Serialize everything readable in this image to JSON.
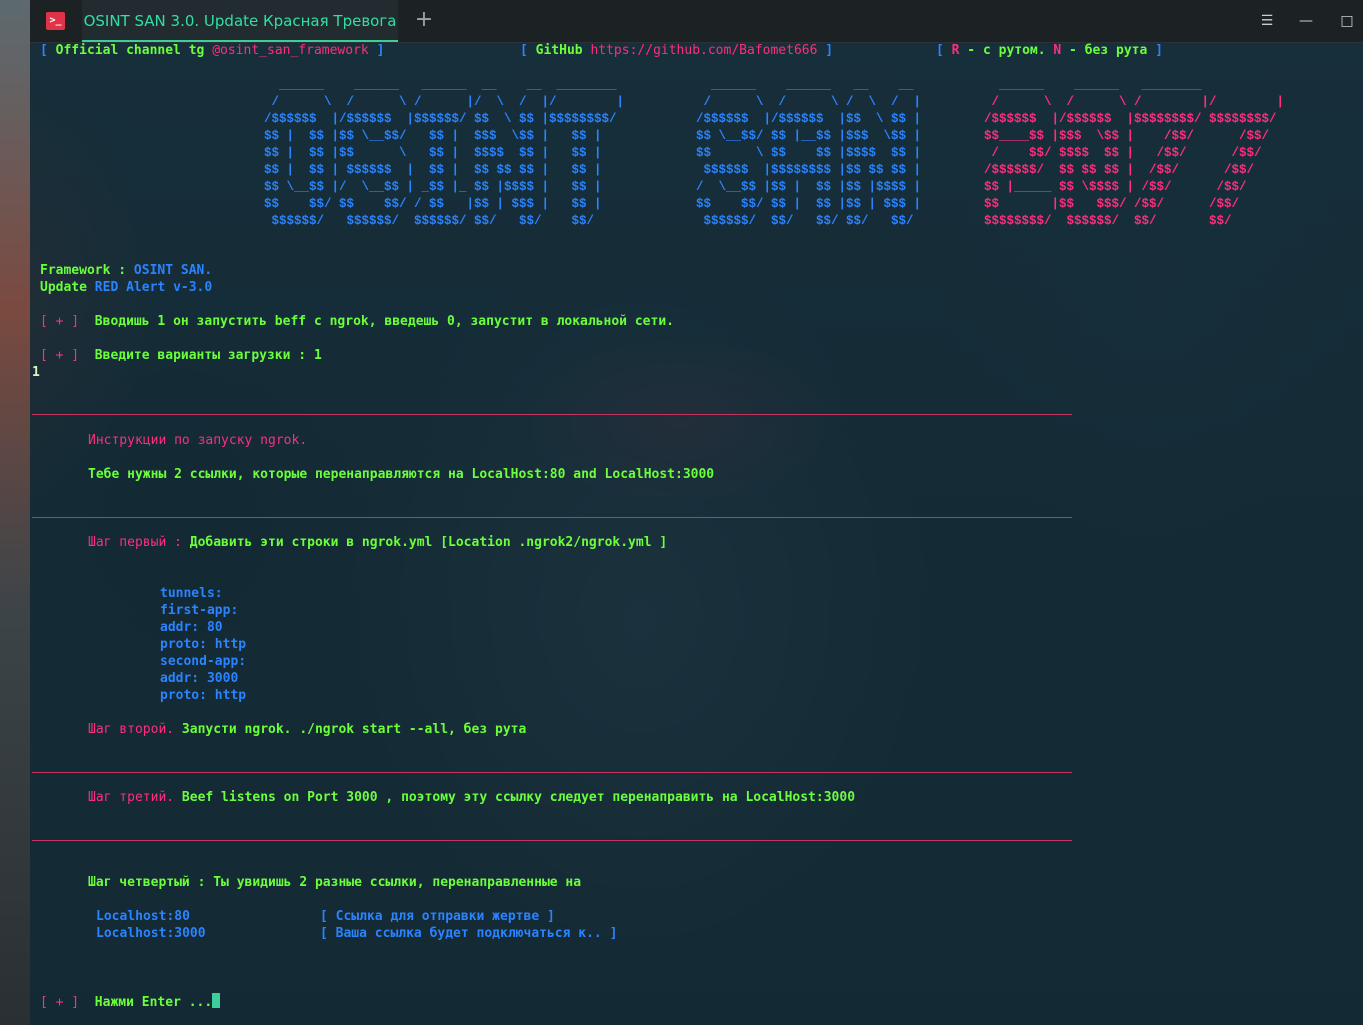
{
  "window": {
    "tab_title": "OSINT SAN 3.0. Update Красная Тревога",
    "new_tab": "+",
    "menu_glyph": "☰",
    "minimize_glyph": "—",
    "maximize_glyph": "□"
  },
  "header": {
    "channel_bracket_open": "[",
    "channel_label": "Official channel tg",
    "channel_handle": "@osint_san_framework",
    "channel_bracket_close": "]",
    "github_bracket_open": "[",
    "github_label": "GitHub",
    "github_url": "https://github.com/Bafomet666",
    "github_bracket_close": "]",
    "mode_bracket_open": "[",
    "mode_r": "R",
    "mode_r_text": " - с рутом.",
    "mode_n": "N",
    "mode_n_text": " - без рута",
    "mode_bracket_close": "]"
  },
  "banner": {
    "osint": "  ______    ______   ______  __    __  ________\n /      \\  /      \\ /      |/  \\  /  |/        |\n/$$$$$$  |/$$$$$$  |$$$$$$/ $$  \\ $$ |$$$$$$$$/\n$$ |  $$ |$$ \\__$$/   $$ |  $$$  \\$$ |   $$ |\n$$ |  $$ |$$      \\   $$ |  $$$$  $$ |   $$ |\n$$ |  $$ | $$$$$$  |  $$ |  $$ $$ $$ |   $$ |\n$$ \\__$$ |/  \\__$$ | _$$ |_ $$ |$$$$ |   $$ |\n$$    $$/ $$    $$/ / $$   |$$ | $$$ |   $$ |\n $$$$$$/   $$$$$$/  $$$$$$/ $$/   $$/    $$/",
    "san": "  ______    ______   __    __\n /      \\  /      \\ /  \\  /  |\n/$$$$$$  |/$$$$$$  |$$  \\ $$ |\n$$ \\__$$/ $$ |__$$ |$$$  \\$$ |\n$$      \\ $$    $$ |$$$$  $$ |\n $$$$$$  |$$$$$$$$ |$$ $$ $$ |\n/  \\__$$ |$$ |  $$ |$$ |$$$$ |\n$$    $$/ $$ |  $$ |$$ | $$$ |\n $$$$$$/  $$/   $$/ $$/   $$/",
    "v207": "  ______    ______   ________\n /      \\  /      \\ /        |/        |\n/$$$$$$  |/$$$$$$  |$$$$$$$$/ $$$$$$$$/\n$$____$$ |$$$  \\$$ |    /$$/      /$$/\n /    $$/ $$$$  $$ |   /$$/      /$$/\n/$$$$$$/  $$ $$ $$ |  /$$/      /$$/\n$$ |_____ $$ \\$$$$ | /$$/      /$$/\n$$       |$$   $$$/ /$$/      /$$/\n$$$$$$$$/  $$$$$$/  $$/       $$/"
  },
  "info": {
    "framework_label": "Framework : ",
    "framework_value": "OSINT SAN.",
    "update_label": "Update ",
    "update_value": "RED Alert v-3.0"
  },
  "prompts": {
    "marker": "[ + ]",
    "hint": "Вводишь 1 он запустить beff с ngrok, введешь 0, запустит в локальной сети.",
    "choice_label": "Введите варианты загрузки : 1",
    "echo": "1",
    "final": "Нажми Enter ..."
  },
  "instructions": {
    "title": "Инструкции по запуску ngrok.",
    "need_links": "Тебе нужны 2 ссылки, которые перенаправляются на LocalHost:80 and LocalHost:3000",
    "step1_label": "Шаг первый : ",
    "step1_text": "Добавить эти строки в ngrok.yml [Location .ngrok2/ngrok.yml ]",
    "yaml": [
      "tunnels:",
      "first-app:",
      "addr: 80",
      "proto: http",
      "second-app:",
      "addr: 3000",
      "proto: http"
    ],
    "step2_label": "Шаг второй. ",
    "step2_text": "Запусти ngrok. ./ngrok start --all, без рута",
    "step3_label": "Шаг третий. ",
    "step3_text": "Beef listens on Port 3000 , поэтому эту ссылку следует перенаправить на LocalHost:3000",
    "step4_text": "Шаг четвертый : Ты увидишь 2 разные ссылки, перенаправленные на",
    "links": [
      {
        "host": "Localhost:80",
        "desc": "[ Ссылка для отправки жертве ]"
      },
      {
        "host": "Localhost:3000",
        "desc": "[ Ваша ссылка будет подключаться к.. ]"
      }
    ]
  },
  "colors": {
    "green": "#6bff3a",
    "blue": "#2a83ff",
    "pink": "#ff2d7e",
    "tab_accent": "#3ccf99"
  }
}
